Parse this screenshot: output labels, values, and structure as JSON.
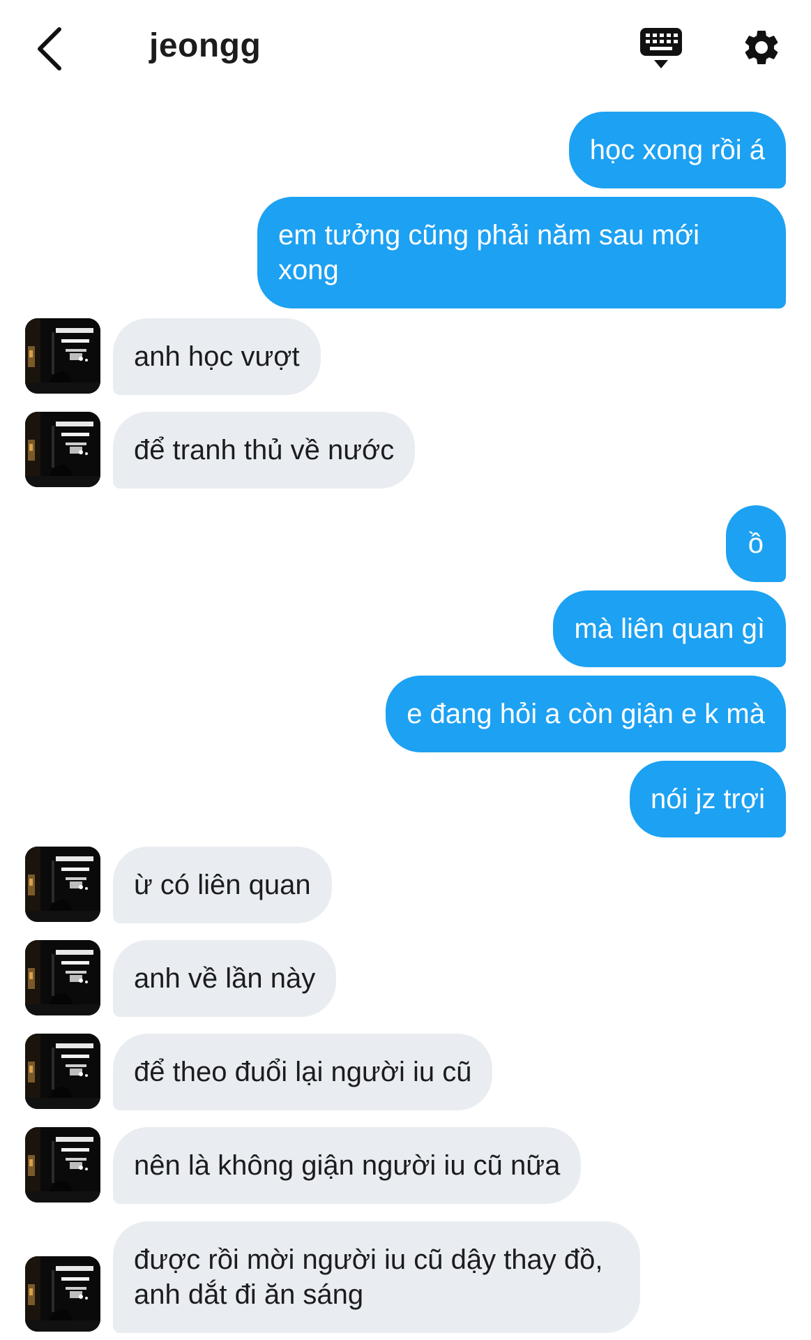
{
  "header": {
    "title": "jeongg",
    "back_icon": "chevron-left-icon",
    "keyboard_icon": "keyboard-icon",
    "settings_icon": "gear-icon"
  },
  "colors": {
    "outgoing_bubble": "#1da1f2",
    "incoming_bubble": "#e9edf1",
    "background": "#ffffff"
  },
  "messages": [
    {
      "side": "out",
      "text": "học xong rồi á"
    },
    {
      "side": "out",
      "text": "em tưởng cũng phải năm sau mới xong"
    },
    {
      "side": "in",
      "text": "anh học vượt"
    },
    {
      "side": "in",
      "text": "để tranh thủ về nước"
    },
    {
      "side": "out",
      "text": "ồ"
    },
    {
      "side": "out",
      "text": "mà liên quan gì"
    },
    {
      "side": "out",
      "text": "e đang hỏi a còn giận e k mà"
    },
    {
      "side": "out",
      "text": "nói jz trợi"
    },
    {
      "side": "in",
      "text": "ừ có liên quan"
    },
    {
      "side": "in",
      "text": "anh về lần này"
    },
    {
      "side": "in",
      "text": "để theo đuổi lại người iu cũ"
    },
    {
      "side": "in",
      "text": "nên là không giận người iu cũ nữa"
    },
    {
      "side": "in",
      "text": "được rồi mời người iu cũ dậy thay đồ, anh dắt đi ăn sáng"
    }
  ]
}
